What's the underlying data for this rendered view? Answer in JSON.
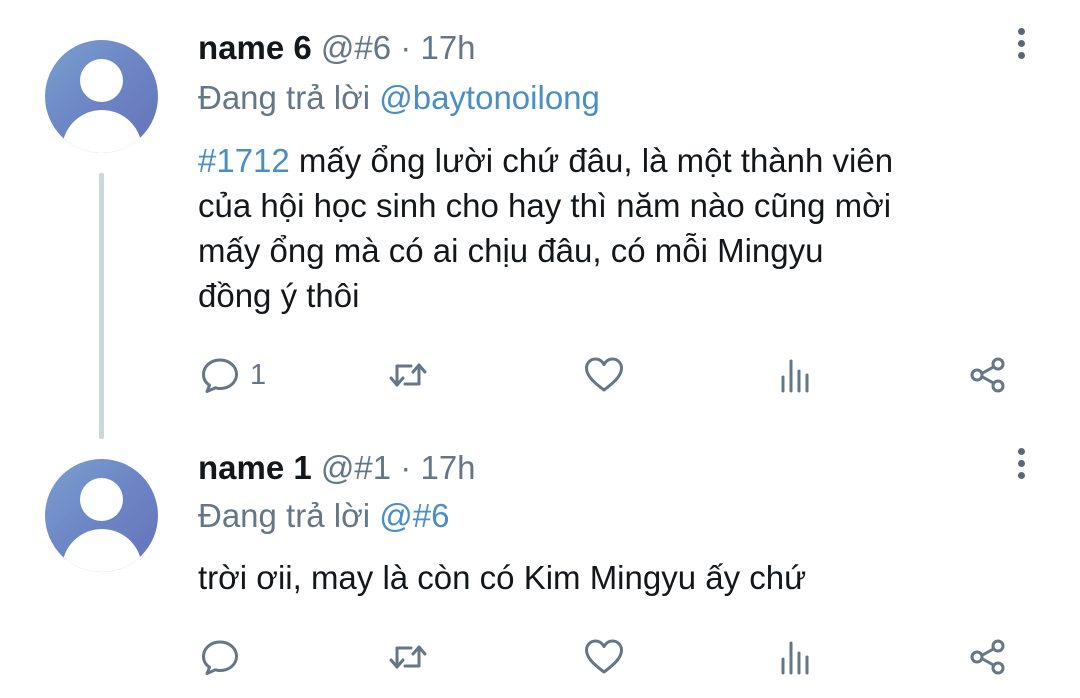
{
  "tweets": [
    {
      "name": "name 6",
      "handle": "@#6",
      "dot": "·",
      "time": "17h",
      "reply_prefix": "Đang trả lời",
      "reply_to": "@baytonoilong",
      "hashtag": "#1712",
      "text_line1": " mấy ổng lười chứ đâu, là một thành viên",
      "text_line2": "của hội học sinh cho hay thì năm nào cũng mời",
      "text_line3": "mấy ổng mà có ai chịu đâu, có mỗi Mingyu",
      "text_line4": "đồng ý thôi",
      "reply_count": "1"
    },
    {
      "name": "name 1",
      "handle": "@#1",
      "dot": "·",
      "time": "17h",
      "reply_prefix": "Đang trả lời",
      "reply_to": "@#6",
      "text_line1": "trời ơii, may là còn có Kim Mingyu ấy chứ",
      "reply_count": ""
    }
  ],
  "colors": {
    "link": "#4a8ec5",
    "secondary_text": "#657786",
    "icon": "#657786",
    "thread_line": "#ccd6dd"
  },
  "icons": [
    "reply-icon",
    "retweet-icon",
    "like-icon",
    "stats-icon",
    "share-icon",
    "more-options-icon"
  ]
}
